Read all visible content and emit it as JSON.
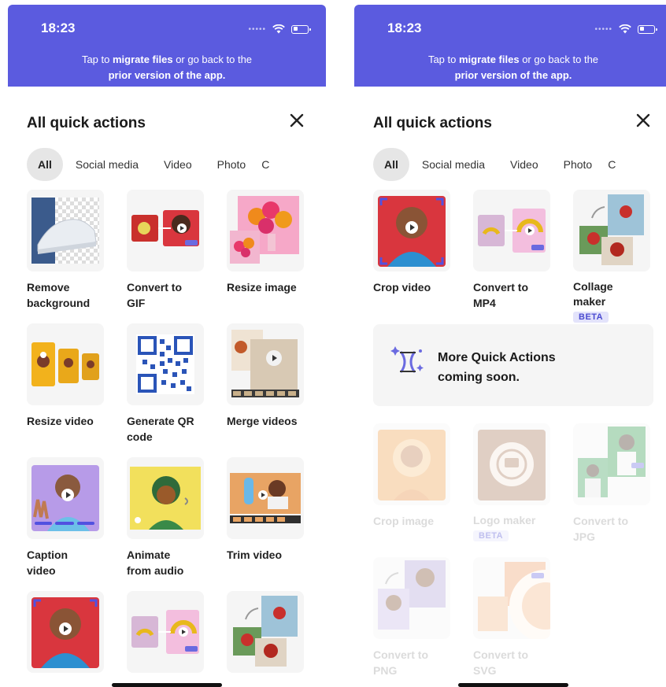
{
  "left": {
    "clock": "18:23",
    "banner": {
      "prefix": "Tap to ",
      "link": "migrate files",
      "middle": " or go back to the",
      "line2": "prior version of the app."
    },
    "title": "All quick actions",
    "tabs": [
      "All",
      "Social media",
      "Video",
      "Photo",
      "C"
    ],
    "tiles": [
      {
        "line1": "Remove",
        "line2": "background"
      },
      {
        "line1": "Convert to",
        "line2": "GIF"
      },
      {
        "line1": "Resize image",
        "line2": ""
      },
      {
        "line1": "Resize video",
        "line2": ""
      },
      {
        "line1": "Generate QR",
        "line2": "code"
      },
      {
        "line1": "Merge videos",
        "line2": ""
      },
      {
        "line1": "Caption",
        "line2": "video"
      },
      {
        "line1": "Animate",
        "line2": "from audio"
      },
      {
        "line1": "Trim video",
        "line2": ""
      },
      {
        "line1": "",
        "line2": ""
      },
      {
        "line1": "",
        "line2": ""
      },
      {
        "line1": "",
        "line2": ""
      }
    ]
  },
  "right": {
    "clock": "18:23",
    "banner": {
      "prefix": "Tap to ",
      "link": "migrate files",
      "middle": " or go back to the",
      "line2": "prior version of the app."
    },
    "title": "All quick actions",
    "tabs": [
      "All",
      "Social media",
      "Video",
      "Photo",
      "C"
    ],
    "tiles": [
      {
        "line1": "Crop video",
        "line2": ""
      },
      {
        "line1": "Convert to",
        "line2": "MP4"
      },
      {
        "line1": "Collage",
        "line2": "maker",
        "badge": "BETA"
      }
    ],
    "coming_soon": {
      "line1": "More Quick Actions",
      "line2": "coming soon."
    },
    "disabled_tiles": [
      {
        "line1": "Crop image",
        "line2": ""
      },
      {
        "line1": "Logo maker",
        "line2": "",
        "badge": "BETA"
      },
      {
        "line1": "Convert to",
        "line2": "JPG"
      },
      {
        "line1": "Convert to",
        "line2": "PNG"
      },
      {
        "line1": "Convert to",
        "line2": "SVG"
      }
    ]
  },
  "colors": {
    "banner": "#5b5bdf",
    "accent": "#4b4bd0",
    "tile_bg": "#f5f5f5",
    "active_tab": "#e6e6e6"
  }
}
